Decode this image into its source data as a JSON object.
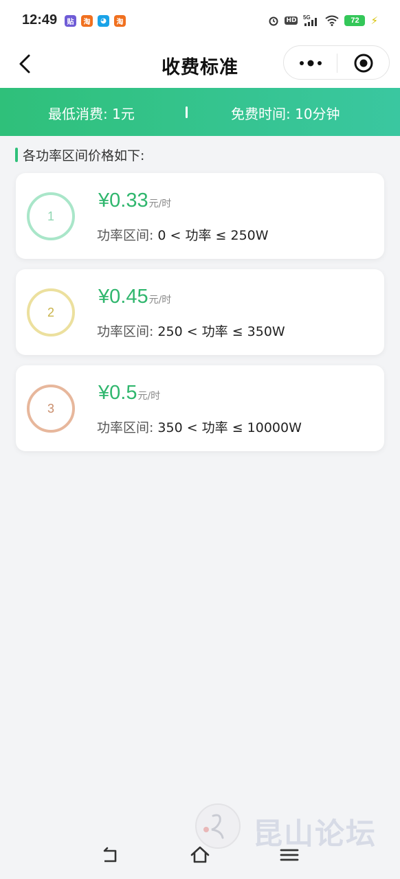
{
  "status_bar": {
    "time": "12:49",
    "apps": [
      {
        "icon": "tieba-icon",
        "glyph": "贴",
        "color": "#6f5cd6"
      },
      {
        "icon": "taobao-icon",
        "glyph": "淘",
        "color": "#f0701f"
      },
      {
        "icon": "bilibili-icon",
        "glyph": "◕",
        "color": "#1aa3e8"
      },
      {
        "icon": "taobao-icon",
        "glyph": "淘",
        "color": "#f0701f"
      }
    ],
    "hd_label": "HD",
    "network_label": "5G",
    "battery": "72"
  },
  "nav": {
    "title": "收费标准"
  },
  "banner": {
    "min_charge": "最低消费: 1元",
    "free_time": "免费时间: 10分钟"
  },
  "section": {
    "heading": "各功率区间价格如下:"
  },
  "tiers": [
    {
      "number": "1",
      "price": "¥0.33",
      "unit": "元/时",
      "range_label": "功率区间:",
      "range_value": "0 < 功率 ≤ 250W",
      "color": "#a9e6c9"
    },
    {
      "number": "2",
      "price": "¥0.45",
      "unit": "元/时",
      "range_label": "功率区间:",
      "range_value": "250 < 功率 ≤ 350W",
      "color": "#ece09e"
    },
    {
      "number": "3",
      "price": "¥0.5",
      "unit": "元/时",
      "range_label": "功率区间:",
      "range_value": "350 < 功率 ≤ 10000W",
      "color": "#e7b79c"
    }
  ],
  "tier_number_colors": [
    "#8fd6b2",
    "#c9b34a",
    "#c98d6c"
  ],
  "accent_color": "#2fc07a",
  "watermark": {
    "text": "昆山论坛"
  }
}
